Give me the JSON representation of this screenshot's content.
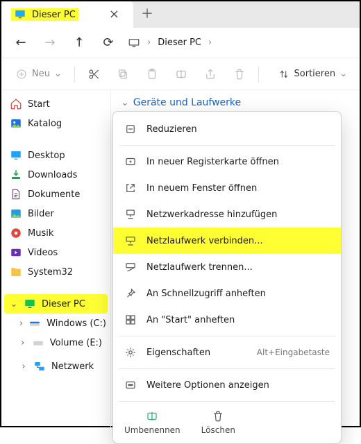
{
  "tab": {
    "title": "Dieser PC"
  },
  "address": {
    "location": "Dieser PC"
  },
  "toolbar": {
    "new": "Neu",
    "sort": "Sortieren"
  },
  "sidebar": {
    "quick": [
      {
        "label": "Start"
      },
      {
        "label": "Katalog"
      }
    ],
    "places": [
      {
        "label": "Desktop"
      },
      {
        "label": "Downloads"
      },
      {
        "label": "Dokumente"
      },
      {
        "label": "Bilder"
      },
      {
        "label": "Musik"
      },
      {
        "label": "Videos"
      },
      {
        "label": "System32"
      }
    ],
    "tree": {
      "thispc": "Dieser PC",
      "children": [
        {
          "label": "Windows (C:)"
        },
        {
          "label": "Volume (E:)"
        }
      ],
      "network": "Netzwerk"
    }
  },
  "content": {
    "section": "Geräte und Laufwerke"
  },
  "context": {
    "items": [
      {
        "label": "Reduzieren"
      },
      {
        "label": "In neuer Registerkarte öffnen"
      },
      {
        "label": "In neuem Fenster öffnen"
      },
      {
        "label": "Netzwerkadresse hinzufügen"
      },
      {
        "label": "Netzlaufwerk verbinden..."
      },
      {
        "label": "Netzlaufwerk trennen..."
      },
      {
        "label": "An Schnellzugriff anheften"
      },
      {
        "label": "An \"Start\" anheften"
      },
      {
        "label": "Eigenschaften",
        "hint": "Alt+Eingabetaste"
      },
      {
        "label": "Weitere Optionen anzeigen"
      }
    ],
    "actions": {
      "rename": "Umbenennen",
      "delete": "Löschen"
    }
  }
}
